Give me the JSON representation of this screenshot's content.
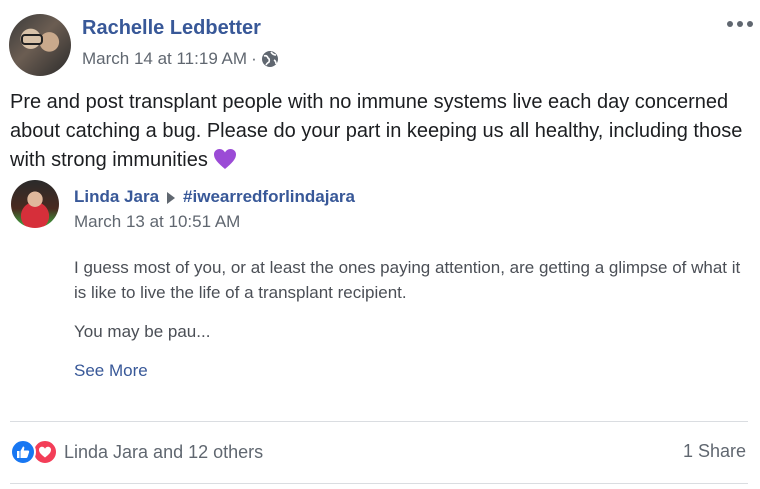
{
  "post": {
    "author": "Rachelle Ledbetter",
    "date": "March 14 at 11:19 AM",
    "separator": "·",
    "privacy_icon": "globe-icon",
    "text": "Pre and post transplant people with no immune systems live each day concerned about catching a bug. Please do your part in keeping us all healthy, including those with strong immunities",
    "emoji": "purple-heart-icon"
  },
  "shared": {
    "author": "Linda Jara",
    "target": "#iwearredforlindajara",
    "date": "March 13 at 10:51 AM",
    "paragraph1": "I guess most of you, or at least the ones paying attention, are getting a glimpse of what it is like to live the life of a transplant recipient.",
    "paragraph2": "You may be pau...",
    "see_more": "See More"
  },
  "footer": {
    "reactions_text": "Linda Jara and 12 others",
    "reaction_icons": [
      "like-icon",
      "love-icon"
    ],
    "share_count": "1 Share"
  },
  "colors": {
    "link_blue": "#385898",
    "meta_gray": "#606770",
    "like_blue": "#1877f2",
    "love_red": "#f33e58",
    "heart_purple": "#9b4bd6"
  }
}
